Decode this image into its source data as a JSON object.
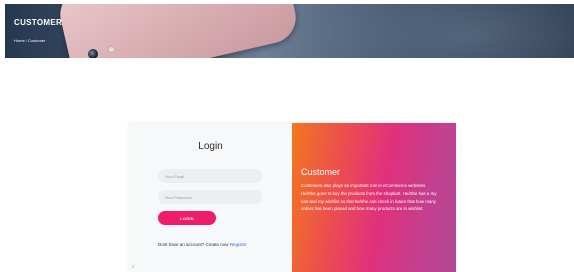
{
  "header": {
    "title": "CUSTOMER",
    "breadcrumb": "Home / Customer"
  },
  "login": {
    "title": "Login",
    "email_placeholder": "Your Email",
    "password_placeholder": "Your Password",
    "login_label": "LOGIN",
    "no_account_text": "Dont have an account? Create now",
    "register_label": "Register",
    "corner_mark": "≡"
  },
  "info": {
    "title": "Customer",
    "description": "Customers also plays an important role in eCommerce websites. He/She goes to buy the products from the shopkart. He/She has a my cart and my wishlist so that he/she can check in future that how many orders has been placed and how many products are in wishlist."
  },
  "colors": {
    "login_button": "#ee1d6c",
    "register_link": "#3a6fd8",
    "gradient_start": "#f2781f",
    "gradient_end": "#b24a92"
  }
}
